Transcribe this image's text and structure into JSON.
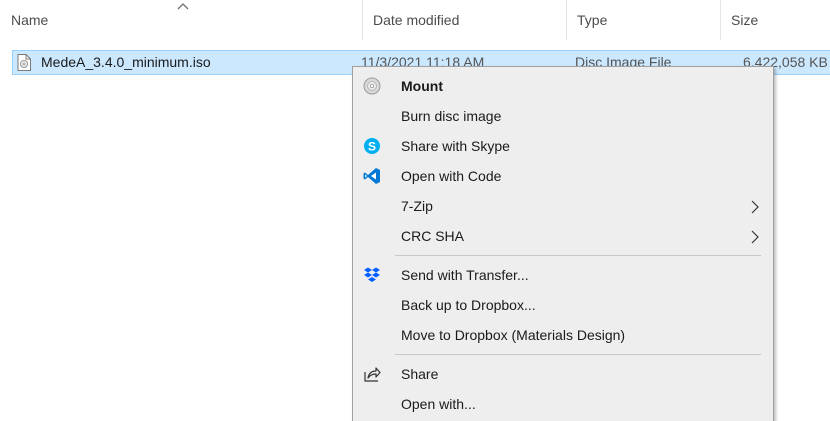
{
  "columns": {
    "name": "Name",
    "date_modified": "Date modified",
    "type": "Type",
    "size": "Size"
  },
  "file": {
    "name": "MedeA_3.4.0_minimum.iso",
    "date_modified": "11/3/2021 11:18 AM",
    "type": "Disc Image File",
    "size": "6,422,058 KB",
    "icon": "disc-image-file-icon"
  },
  "context_menu": {
    "items": [
      {
        "label": "Mount",
        "icon": "disc-icon",
        "bold": true
      },
      {
        "label": "Burn disc image"
      },
      {
        "label": "Share with Skype",
        "icon": "skype-icon"
      },
      {
        "label": "Open with Code",
        "icon": "vscode-icon"
      },
      {
        "label": "7-Zip",
        "submenu": true
      },
      {
        "label": "CRC SHA",
        "submenu": true
      },
      {
        "label": "Send with Transfer...",
        "icon": "dropbox-icon"
      },
      {
        "label": "Back up to Dropbox..."
      },
      {
        "label": "Move to Dropbox (Materials Design)"
      },
      {
        "label": "Share",
        "icon": "share-icon"
      },
      {
        "label": "Open with..."
      }
    ]
  },
  "colors": {
    "selection_bg": "#cce8ff",
    "selection_border": "#99d1ff",
    "menu_bg": "#eeeeee",
    "skype_blue": "#00aff0",
    "vscode_blue": "#0078d4",
    "dropbox_blue": "#0061fe"
  }
}
